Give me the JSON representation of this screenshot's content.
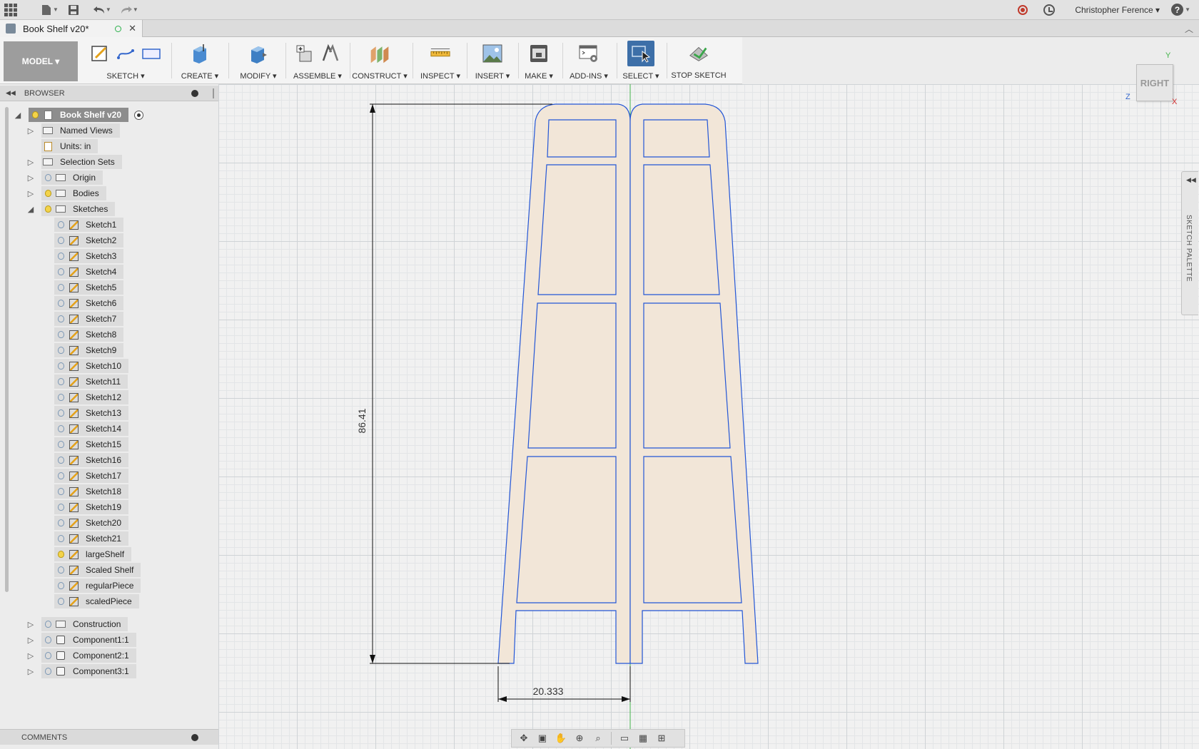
{
  "app": {
    "user_name": "Christopher Ference ▾",
    "help_label": "?",
    "doc_title": "Book Shelf v20*"
  },
  "ribbon": {
    "model_label": "MODEL ▾",
    "groups": {
      "sketch": "SKETCH ▾",
      "create": "CREATE ▾",
      "modify": "MODIFY ▾",
      "assemble": "ASSEMBLE ▾",
      "construct": "CONSTRUCT ▾",
      "inspect": "INSPECT ▾",
      "insert": "INSERT ▾",
      "make": "MAKE ▾",
      "addins": "ADD-INS ▾",
      "select": "SELECT ▾",
      "stop_sketch": "STOP SKETCH"
    }
  },
  "browser": {
    "header": "BROWSER",
    "root": "Book Shelf v20",
    "named_views": "Named Views",
    "units": "Units: in",
    "selection_sets": "Selection Sets",
    "origin": "Origin",
    "bodies": "Bodies",
    "sketches": "Sketches",
    "sketch_items": [
      "Sketch1",
      "Sketch2",
      "Sketch3",
      "Sketch4",
      "Sketch5",
      "Sketch6",
      "Sketch7",
      "Sketch8",
      "Sketch9",
      "Sketch10",
      "Sketch11",
      "Sketch12",
      "Sketch13",
      "Sketch14",
      "Sketch15",
      "Sketch16",
      "Sketch17",
      "Sketch18",
      "Sketch19",
      "Sketch20",
      "Sketch21",
      "largeShelf",
      "Scaled Shelf",
      "regularPiece",
      "scaledPiece"
    ],
    "construction": "Construction",
    "components": [
      "Component1:1",
      "Component2:1",
      "Component3:1"
    ]
  },
  "comments": {
    "header": "COMMENTS"
  },
  "viewcube": {
    "face": "RIGHT",
    "axis_y": "Y",
    "axis_z": "Z",
    "axis_x": "X"
  },
  "palette": {
    "label": "SKETCH PALETTE"
  },
  "dimensions": {
    "height": "86.41",
    "width": "20.333"
  },
  "colors": {
    "sketch_line": "#2356d6",
    "profile_fill": "#f2e6d8",
    "accent_select": "#3d6fa8"
  }
}
